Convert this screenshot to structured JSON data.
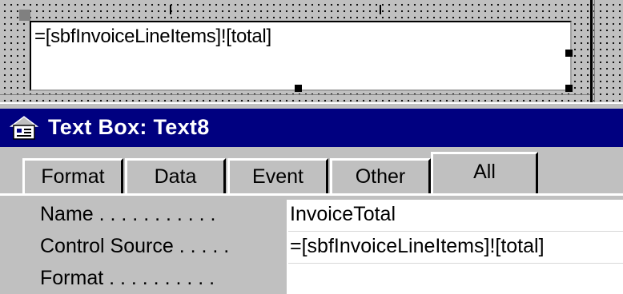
{
  "design_surface": {
    "textbox_expression": "=[sbfInvoiceLineItems]![total]"
  },
  "property_sheet": {
    "title": "Text Box: Text8",
    "icon": "properties-sheet-icon",
    "tabs": [
      {
        "label": "Format",
        "active": false
      },
      {
        "label": "Data",
        "active": false
      },
      {
        "label": "Event",
        "active": false
      },
      {
        "label": "Other",
        "active": false
      },
      {
        "label": "All",
        "active": true
      }
    ],
    "properties": [
      {
        "label": "Name . . . . . . . . . . .",
        "value": "InvoiceTotal"
      },
      {
        "label": "Control Source . . . . .",
        "value": "=[sbfInvoiceLineItems]![total]"
      },
      {
        "label": "Format . . . . . . . . . .",
        "value": ""
      }
    ]
  },
  "colors": {
    "title_bar": "#000080",
    "face": "#c0c0c0",
    "window": "#ffffff"
  }
}
